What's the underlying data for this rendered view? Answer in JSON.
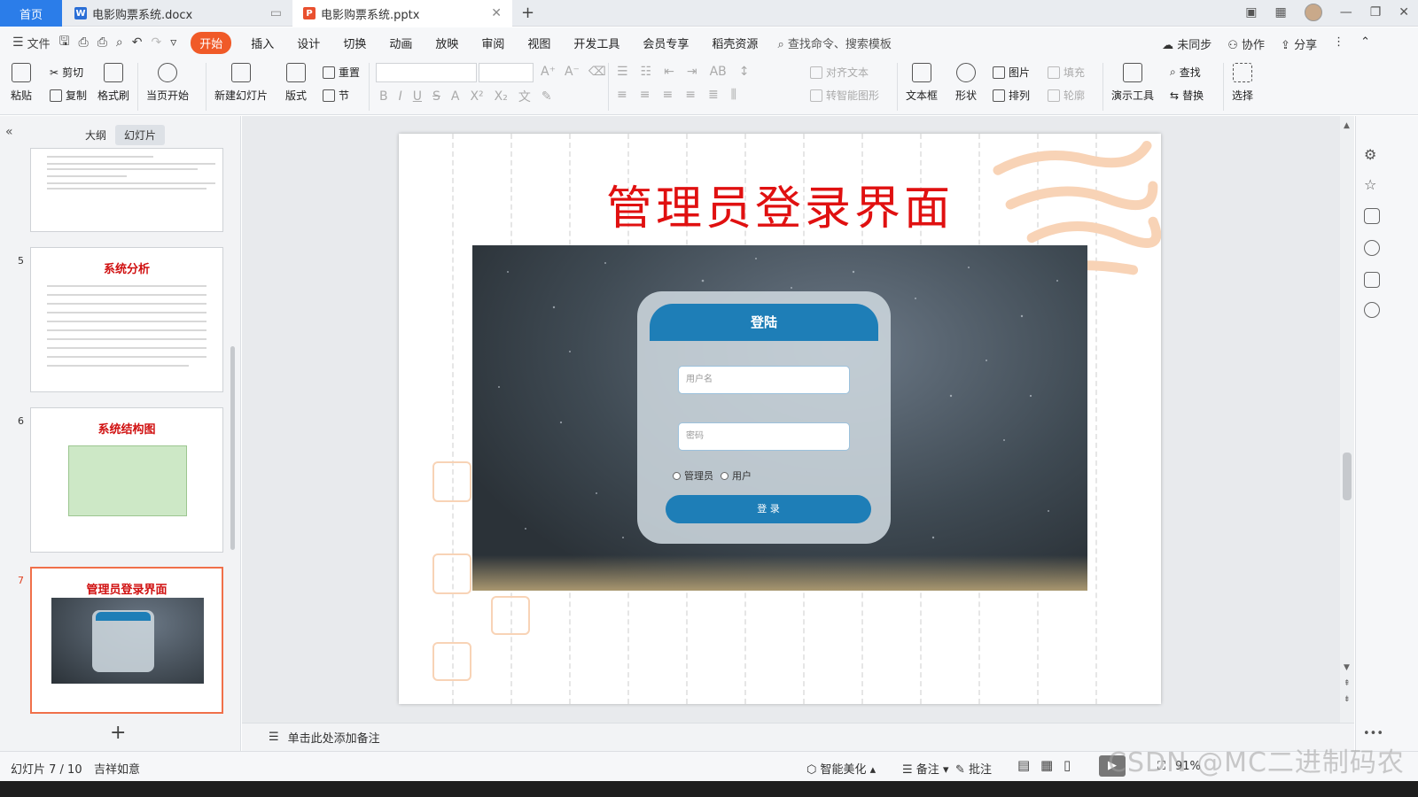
{
  "tabs": {
    "home": "首页",
    "doc": "电影购票系统.docx",
    "ppt": "电影购票系统.pptx",
    "new_tab": "+"
  },
  "menu": {
    "file": "文件",
    "items": [
      "开始",
      "插入",
      "设计",
      "切换",
      "动画",
      "放映",
      "审阅",
      "视图",
      "开发工具",
      "会员专享",
      "稻壳资源"
    ],
    "search": "查找命令、搜索模板",
    "sync": "未同步",
    "collab": "协作",
    "share": "分享"
  },
  "ribbon": {
    "paste": "粘贴",
    "cut": "剪切",
    "copy": "复制",
    "format_painter": "格式刷",
    "from_current": "当页开始",
    "new_slide": "新建幻灯片",
    "layout": "版式",
    "reset": "重置",
    "section": "节",
    "align_text": "对齐文本",
    "to_smartart": "转智能图形",
    "textbox": "文本框",
    "shape": "形状",
    "arrange": "排列",
    "picture": "图片",
    "fill": "填充",
    "outline": "轮廓",
    "presenter": "演示工具",
    "find": "查找",
    "replace": "替换",
    "select": "选择"
  },
  "left_panel": {
    "tab_outline": "大纲",
    "tab_slides": "幻灯片",
    "slides": [
      {
        "num": "",
        "title": ""
      },
      {
        "num": "5",
        "title": "系统分析"
      },
      {
        "num": "6",
        "title": "系统结构图"
      },
      {
        "num": "7",
        "title": "管理员登录界面"
      }
    ],
    "add_slide": "+"
  },
  "slide": {
    "title": "管理员登录界面",
    "login": {
      "header": "登陆",
      "username_placeholder": "用户名",
      "password_placeholder": "密码",
      "radio_admin": "管理员",
      "radio_user": "用户",
      "submit": "登 录"
    }
  },
  "notes": {
    "placeholder": "单击此处添加备注"
  },
  "status": {
    "slide_count": "幻灯片 7 / 10",
    "theme": "吉祥如意",
    "beautify": "智能美化",
    "notes_btn": "备注",
    "comment_btn": "批注",
    "zoom": "91%"
  },
  "watermark": "CSDN @MC二进制码农",
  "colors": {
    "accent": "#f05a28",
    "title_red": "#e01010",
    "login_blue": "#1e7eb7",
    "stamp": "#f8d3b6"
  }
}
